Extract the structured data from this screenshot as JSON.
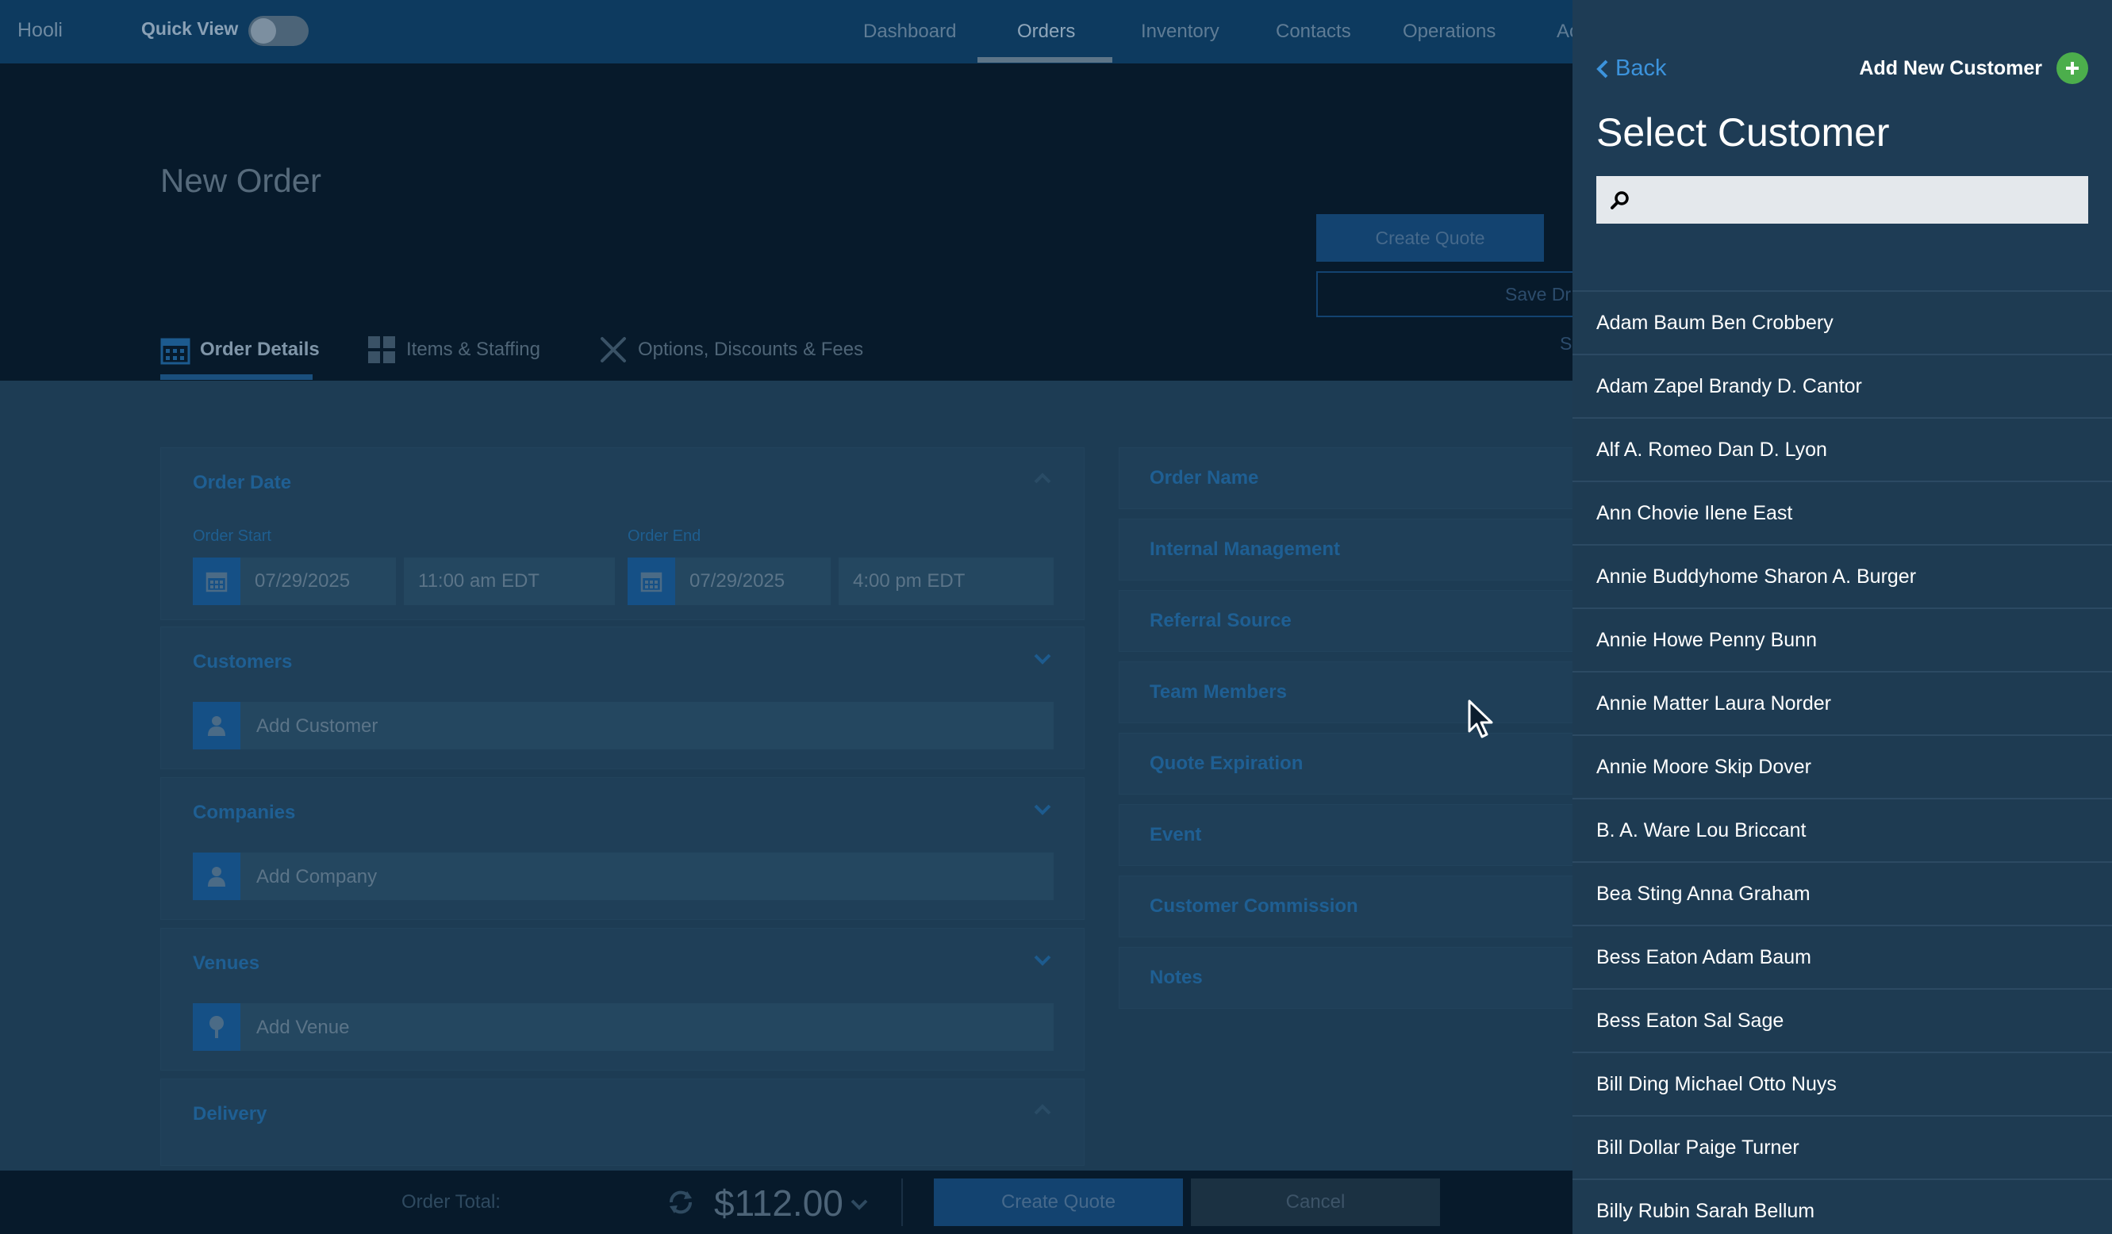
{
  "app": {
    "brand": "Hooli",
    "quick_view_label": "Quick View"
  },
  "nav": {
    "items": [
      "Dashboard",
      "Orders",
      "Inventory",
      "Contacts",
      "Operations",
      "Ac"
    ],
    "active": "Orders"
  },
  "page": {
    "title": "New Order"
  },
  "actions": {
    "create_quote": "Create Quote",
    "save_draft": "Save Dr"
  },
  "tabs": [
    {
      "label": "Order Details",
      "icon": "calendar-icon"
    },
    {
      "label": "Items & Staffing",
      "icon": "grid-icon"
    },
    {
      "label": "Options, Discounts & Fees",
      "icon": "tools-icon"
    }
  ],
  "tabs_extra": "S",
  "order_date": {
    "title": "Order Date",
    "start_label": "Order Start",
    "end_label": "Order End",
    "start_date": "07/29/2025",
    "start_time": "11:00 am EDT",
    "end_date": "07/29/2025",
    "end_time": "4:00 pm EDT"
  },
  "customers": {
    "title": "Customers",
    "add": "Add Customer"
  },
  "companies": {
    "title": "Companies",
    "add": "Add Company"
  },
  "venues": {
    "title": "Venues",
    "add": "Add Venue"
  },
  "delivery": {
    "title": "Delivery"
  },
  "right_cards": [
    "Order Name",
    "Internal Management",
    "Referral Source",
    "Team Members",
    "Quote Expiration",
    "Event",
    "Customer Commission",
    "Notes"
  ],
  "footer": {
    "total_label": "Order Total:",
    "total_value": "$112.00",
    "create_quote": "Create Quote",
    "cancel": "Cancel"
  },
  "panel": {
    "back": "Back",
    "add_new": "Add New Customer",
    "title": "Select Customer",
    "search_placeholder": "",
    "customers": [
      "Adam Baum Ben Crobbery",
      "Adam Zapel Brandy D. Cantor",
      "Alf A. Romeo Dan D. Lyon",
      "Ann Chovie Ilene East",
      "Annie Buddyhome Sharon A. Burger",
      "Annie Howe Penny Bunn",
      "Annie Matter Laura Norder",
      "Annie Moore Skip Dover",
      "B. A. Ware Lou Briccant",
      "Bea Sting Anna Graham",
      "Bess Eaton Adam Baum",
      "Bess Eaton Sal Sage",
      "Bill Ding Michael Otto Nuys",
      "Bill Dollar Paige Turner",
      "Billy Rubin Sarah Bellum"
    ]
  },
  "colors": {
    "accent": "#3c93dc",
    "add_green": "#4cae4c",
    "panel_bg": "#1e3b52",
    "topbar": "#0d3a5f"
  }
}
